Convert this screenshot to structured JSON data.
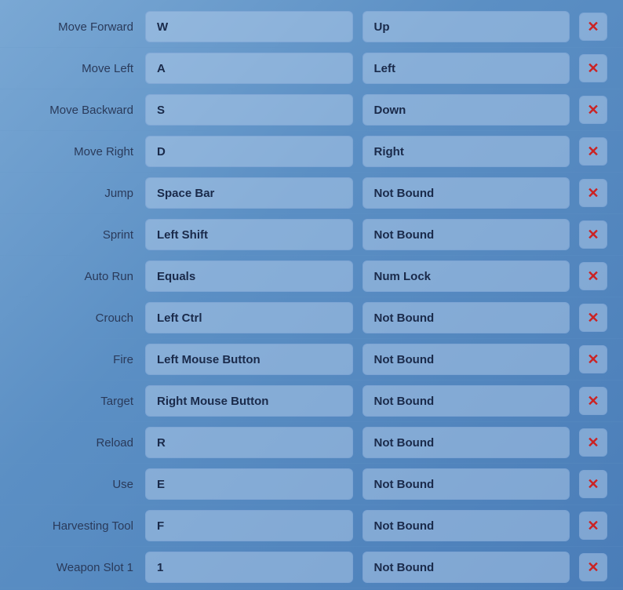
{
  "keybinds": [
    {
      "action": "Move Forward",
      "primary": "W",
      "secondary": "Up",
      "hasSecondary": true
    },
    {
      "action": "Move Left",
      "primary": "A",
      "secondary": "Left",
      "hasSecondary": true
    },
    {
      "action": "Move Backward",
      "primary": "S",
      "secondary": "Down",
      "hasSecondary": true
    },
    {
      "action": "Move Right",
      "primary": "D",
      "secondary": "Right",
      "hasSecondary": true
    },
    {
      "action": "Jump",
      "primary": "Space Bar",
      "secondary": "Not Bound",
      "hasSecondary": false
    },
    {
      "action": "Sprint",
      "primary": "Left Shift",
      "secondary": "Not Bound",
      "hasSecondary": false
    },
    {
      "action": "Auto Run",
      "primary": "Equals",
      "secondary": "Num Lock",
      "hasSecondary": true
    },
    {
      "action": "Crouch",
      "primary": "Left Ctrl",
      "secondary": "Not Bound",
      "hasSecondary": false
    },
    {
      "action": "Fire",
      "primary": "Left Mouse Button",
      "secondary": "Not Bound",
      "hasSecondary": false
    },
    {
      "action": "Target",
      "primary": "Right Mouse Button",
      "secondary": "Not Bound",
      "hasSecondary": false
    },
    {
      "action": "Reload",
      "primary": "R",
      "secondary": "Not Bound",
      "hasSecondary": false
    },
    {
      "action": "Use",
      "primary": "E",
      "secondary": "Not Bound",
      "hasSecondary": false
    },
    {
      "action": "Harvesting Tool",
      "primary": "F",
      "secondary": "Not Bound",
      "hasSecondary": false
    },
    {
      "action": "Weapon Slot 1",
      "primary": "1",
      "secondary": "Not Bound",
      "hasSecondary": false
    }
  ],
  "labels": {
    "not_bound": "Not Bound",
    "clear_icon": "✕"
  }
}
